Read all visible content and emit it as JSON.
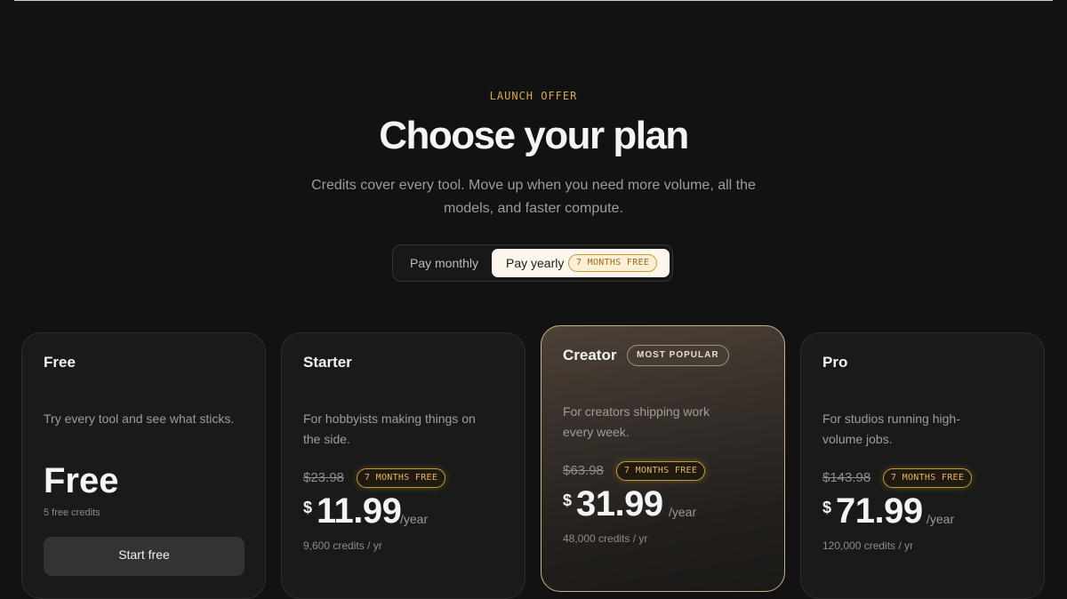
{
  "header": {
    "eyebrow": "LAUNCH OFFER",
    "title": "Choose your plan",
    "subtitle": "Credits cover every tool. Move up when you need more volume, all the models, and faster compute."
  },
  "billing_toggle": {
    "monthly_label": "Pay monthly",
    "yearly_label": "Pay yearly",
    "yearly_badge": "7 MONTHS FREE",
    "selected": "yearly"
  },
  "plans": [
    {
      "name": "Free",
      "description": "Try every tool and see what sticks.",
      "price": "Free",
      "credits": "5 free credits",
      "cta": "Start free"
    },
    {
      "name": "Starter",
      "description": "For hobbyists making things on the side.",
      "original_price": "$23.98",
      "badge": "7 MONTHS FREE",
      "currency": "$",
      "price": "11.99",
      "period": "/year",
      "credits": "9,600 credits / yr"
    },
    {
      "name": "Creator",
      "tag": "MOST POPULAR",
      "description": "For creators shipping work every week.",
      "original_price": "$63.98",
      "badge": "7 MONTHS FREE",
      "currency": "$",
      "price": "31.99",
      "period": "/year",
      "credits": "48,000 credits / yr"
    },
    {
      "name": "Pro",
      "description": "For studios running high-volume jobs.",
      "original_price": "$143.98",
      "badge": "7 MONTHS FREE",
      "currency": "$",
      "price": "71.99",
      "period": "/year",
      "credits": "120,000 credits / yr"
    }
  ],
  "colors": {
    "background": "#121212",
    "accent_gold": "#d9a74e",
    "card": "#1a1a1a",
    "featured_border": "#c9b08a"
  }
}
